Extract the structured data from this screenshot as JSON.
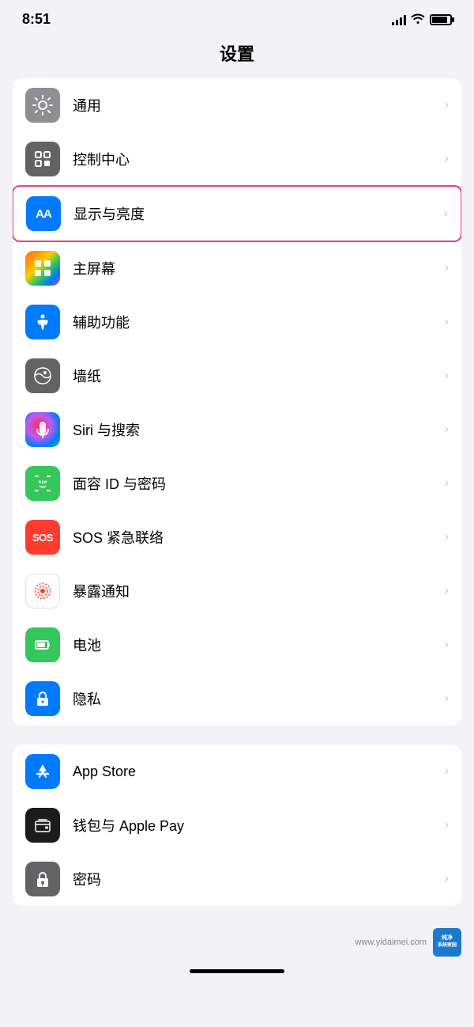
{
  "statusBar": {
    "time": "8:51"
  },
  "pageTitle": "设置",
  "group1": {
    "items": [
      {
        "id": "general",
        "label": "通用",
        "iconType": "gear",
        "iconBg": "gray"
      },
      {
        "id": "control-center",
        "label": "控制中心",
        "iconType": "toggle",
        "iconBg": "gray2"
      },
      {
        "id": "display",
        "label": "显示与亮度",
        "iconType": "aa",
        "iconBg": "blue-aa",
        "highlighted": true
      },
      {
        "id": "home-screen",
        "label": "主屏幕",
        "iconType": "colorful",
        "iconBg": "colorful"
      },
      {
        "id": "accessibility",
        "label": "辅助功能",
        "iconType": "accessibility",
        "iconBg": "blue-circle"
      },
      {
        "id": "wallpaper",
        "label": "墙纸",
        "iconType": "flower",
        "iconBg": "flower"
      },
      {
        "id": "siri",
        "label": "Siri 与搜索",
        "iconType": "siri",
        "iconBg": "siri"
      },
      {
        "id": "faceid",
        "label": "面容 ID 与密码",
        "iconType": "faceid",
        "iconBg": "faceid"
      },
      {
        "id": "sos",
        "label": "SOS 紧急联络",
        "iconType": "sos",
        "iconBg": "sos"
      },
      {
        "id": "exposure",
        "label": "暴露通知",
        "iconType": "exposure",
        "iconBg": "exposure"
      },
      {
        "id": "battery",
        "label": "电池",
        "iconType": "battery",
        "iconBg": "battery"
      },
      {
        "id": "privacy",
        "label": "隐私",
        "iconType": "privacy",
        "iconBg": "privacy"
      }
    ]
  },
  "group2": {
    "items": [
      {
        "id": "appstore",
        "label": "App Store",
        "iconType": "appstore",
        "iconBg": "appstore"
      },
      {
        "id": "wallet",
        "label": "钱包与 Apple Pay",
        "iconType": "wallet",
        "iconBg": "wallet"
      },
      {
        "id": "password",
        "label": "密码",
        "iconType": "password",
        "iconBg": "password"
      }
    ]
  },
  "watermark": {
    "text": "www.yidaimei.com",
    "logoText": "纯净\n系统家园"
  }
}
